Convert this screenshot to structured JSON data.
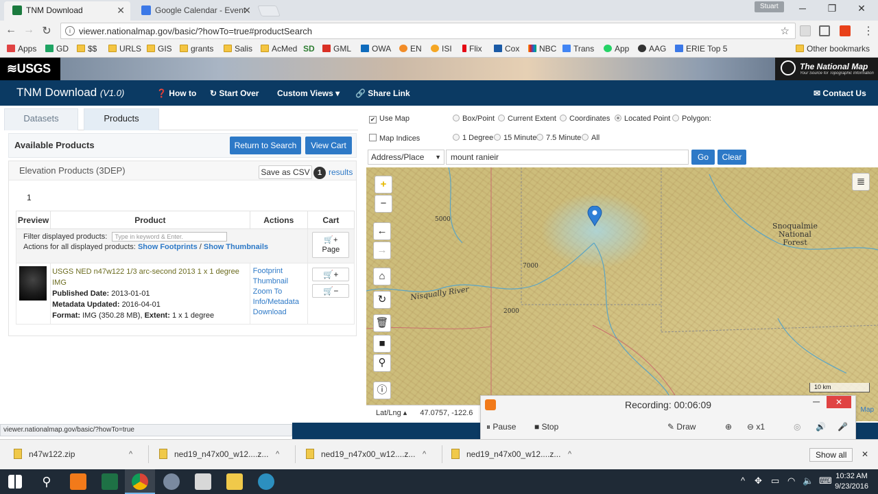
{
  "browser": {
    "tabs": [
      {
        "title": "TNM Download",
        "active": true
      },
      {
        "title": "Google Calendar - Event",
        "active": false
      }
    ],
    "user": "Stuart",
    "url": "viewer.nationalmap.gov/basic/?howTo=true#productSearch",
    "bookmarks": [
      "Apps",
      "GD",
      "$$",
      "URLS",
      "GIS",
      "grants",
      "Salis",
      "AcMed",
      "SD",
      "GML",
      "OWA",
      "EN",
      "ISI",
      "Flix",
      "Cox",
      "NBC",
      "Trans",
      "App",
      "AAG",
      "ERIE Top 5"
    ],
    "other_bookmarks": "Other bookmarks",
    "status_url": "viewer.nationalmap.gov/basic/?howTo=true"
  },
  "banner": {
    "usgs": "USGS",
    "national_map": "The National Map",
    "national_map_sub": "Your Source for Topographic Information"
  },
  "nav": {
    "title": "TNM Download",
    "version": "(V1.0)",
    "howto": "How to",
    "start_over": "Start Over",
    "custom_views": "Custom Views",
    "share_link": "Share Link",
    "contact_us": "Contact Us"
  },
  "panel": {
    "tabs": [
      "Datasets",
      "Products"
    ],
    "available_products": "Available Products",
    "return_to_search": "Return to Search",
    "view_cart": "View Cart",
    "section_title": "Elevation Products (3DEP)",
    "save_csv": "Save as CSV",
    "result_count": "1",
    "results_label": "results",
    "page_number": "1",
    "columns": [
      "Preview",
      "Product",
      "Actions",
      "Cart"
    ],
    "filter_label": "Filter displayed products:",
    "filter_placeholder": "Type in keyword & Enter.",
    "actions_label": "Actions for all displayed products:",
    "show_footprints": "Show Footprints",
    "slash": "/",
    "show_thumbnails": "Show Thumbnails",
    "page_label": "Page",
    "product": {
      "title": "USGS NED n47w122 1/3 arc-second 2013 1 x 1 degree IMG",
      "published_label": "Published Date:",
      "published": "2013-01-01",
      "updated_label": "Metadata Updated:",
      "updated": "2016-04-01",
      "format_label": "Format:",
      "format": "IMG (350.28 MB),",
      "extent_label": "Extent:",
      "extent": "1 x 1 degree",
      "actions": [
        "Footprint",
        "Thumbnail",
        "Zoom To",
        "Info/Metadata",
        "Download"
      ]
    }
  },
  "map_controls": {
    "use_map": "Use Map",
    "box_point": "Box/Point",
    "current_extent": "Current Extent",
    "coordinates": "Coordinates",
    "located_point": "Located Point",
    "polygon": "Polygon:",
    "map_indices": "Map Indices",
    "one_degree": "1 Degree",
    "fifteen_minute": "15 Minute",
    "seven_five_minute": "7.5 Minute",
    "all": "All",
    "search_type": "Address/Place",
    "search_value": "mount ranieir",
    "go": "Go",
    "clear": "Clear"
  },
  "map": {
    "labels": {
      "nisqually": "Nisqually River",
      "snoqualmie": "Snoqualmie National Forest",
      "c5000": "5000",
      "c7000": "7000",
      "c2000": "2000"
    },
    "scale": "10 km",
    "latlng_label": "Lat/Lng",
    "latlng_value": "47.0757, -122.6",
    "attribution": "Map"
  },
  "recording": {
    "label": "Recording:",
    "time": "00:06:09",
    "pause": "Pause",
    "stop": "Stop",
    "draw": "Draw",
    "zoom": "x1"
  },
  "downloads": {
    "items": [
      "n47w122.zip",
      "ned19_n47x00_w12....z...",
      "ned19_n47x00_w12....z...",
      "ned19_n47x00_w12....z..."
    ],
    "show_all": "Show all"
  },
  "taskbar": {
    "time": "10:32 AM",
    "date": "9/23/2016"
  }
}
